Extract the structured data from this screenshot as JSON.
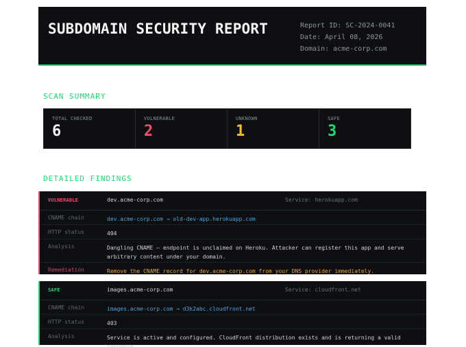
{
  "header": {
    "title": "SUBDOMAIN SECURITY REPORT",
    "report_id": "Report ID: SC-2024-0041",
    "date": "Date: April 08, 2026",
    "domain": "Domain: acme-corp.com"
  },
  "summary": {
    "section_title": "SCAN SUMMARY",
    "stats": [
      {
        "label": "TOTAL CHECKED",
        "value": "6",
        "color": "#f4f4f4"
      },
      {
        "label": "VULNERABLE",
        "value": "2",
        "color": "#f0506e"
      },
      {
        "label": "UNKNOWN",
        "value": "1",
        "color": "#f5c127"
      },
      {
        "label": "SAFE",
        "value": "3",
        "color": "#1fdc74"
      }
    ]
  },
  "findings": {
    "section_title": "DETAILED FINDINGS",
    "items": [
      {
        "status": "VULNERABLE",
        "status_color": "#f0506e",
        "domain": "dev.acme-corp.com",
        "service": "Service: herokuapp.com",
        "cname_label": "CNAME chain",
        "cname": "dev.acme-corp.com → old-dev-app.herokuapp.com",
        "http_label": "HTTP status",
        "http": "404",
        "analysis_label": "Analysis",
        "analysis": "Dangling CNAME — endpoint is unclaimed on Heroku. Attacker can register this app and serve arbitrary content under your domain.",
        "remediation_label": "Remediation",
        "remediation": "Remove the CNAME record for dev.acme-corp.com from your DNS provider immediately."
      },
      {
        "status": "SAFE",
        "status_color": "#1fdc74",
        "domain": "images.acme-corp.com",
        "service": "Service: cloudfront.net",
        "cname_label": "CNAME chain",
        "cname": "images.acme-corp.com → d3k2abc.cloudfront.net",
        "http_label": "HTTP status",
        "http": "403",
        "analysis_label": "Analysis",
        "analysis": "Service is active and configured. CloudFront distribution exists and is returning a valid response."
      }
    ]
  }
}
